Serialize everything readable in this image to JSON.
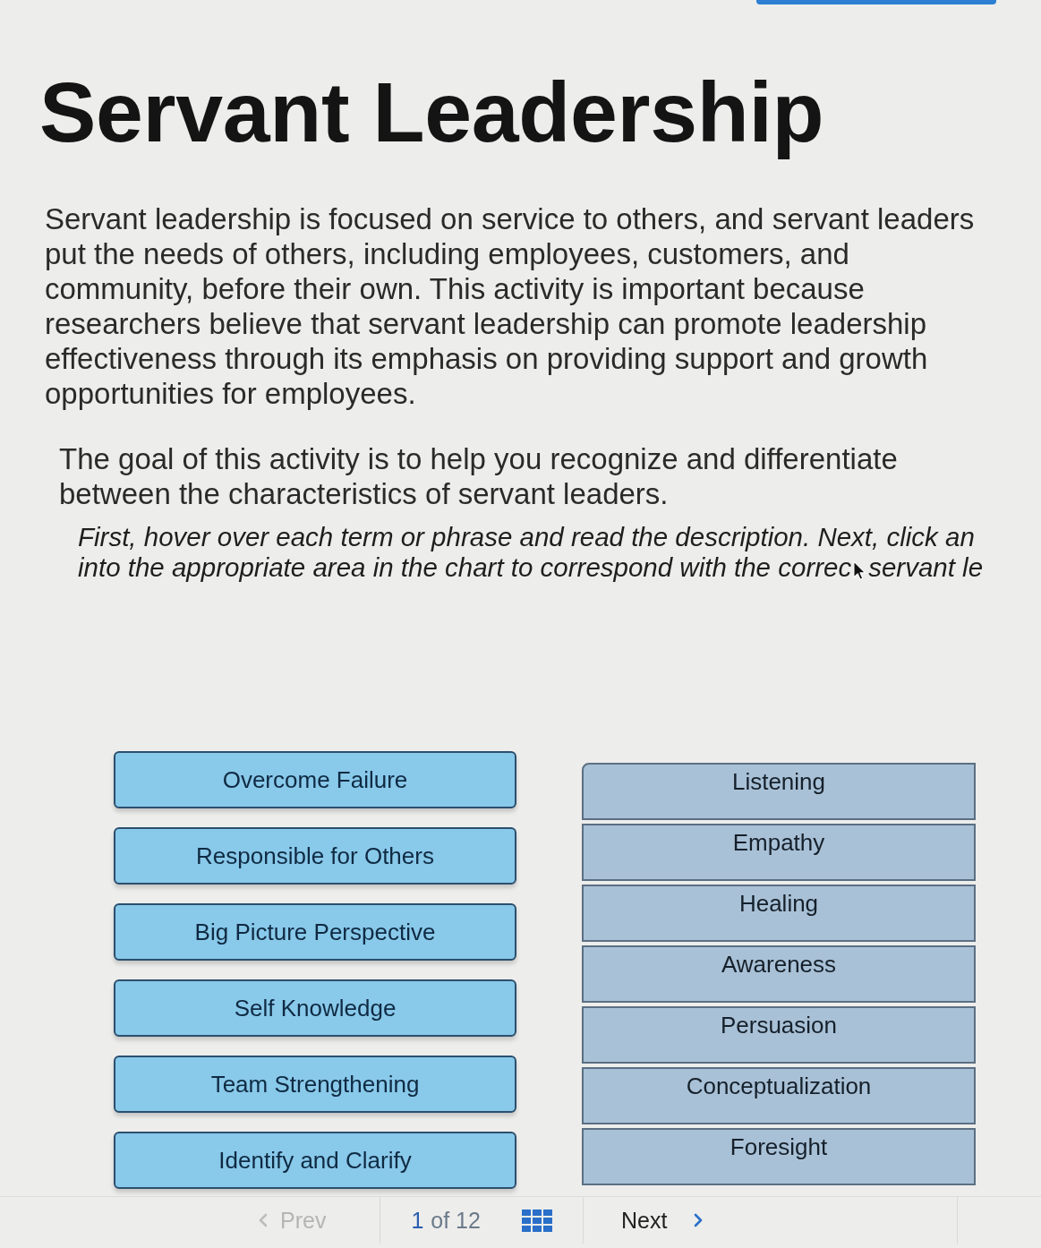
{
  "title": "Servant Leadership",
  "intro": [
    "Servant leadership is focused on service to others, and servant leaders put the needs of others, including employees, customers, and community, before their own. This activity is important because researchers believe that servant leadership can promote leadership effectiveness through its emphasis on providing support and growth opportunities for employees.",
    "The goal of this activity is to help you recognize and differentiate between the characteristics of servant leaders."
  ],
  "instructions": [
    [
      "First, hover over each term or phrase and read the description. Next, click an"
    ],
    [
      "into the appropriate area in the chart to correspond with the correc",
      "servant le"
    ]
  ],
  "terms": [
    {
      "label": "Overcome Failure"
    },
    {
      "label": "Responsible for Others"
    },
    {
      "label": "Big Picture Perspective"
    },
    {
      "label": "Self Knowledge"
    },
    {
      "label": "Team Strengthening"
    },
    {
      "label": "Identify and Clarify"
    }
  ],
  "categories": [
    {
      "label": "Listening"
    },
    {
      "label": "Empathy"
    },
    {
      "label": "Healing"
    },
    {
      "label": "Awareness"
    },
    {
      "label": "Persuasion"
    },
    {
      "label": "Conceptualization"
    },
    {
      "label": "Foresight"
    }
  ],
  "pagination": {
    "prev": {
      "label": "Prev",
      "disabled": true
    },
    "current": "1",
    "total": "of 12",
    "next": {
      "label": "Next",
      "disabled": false
    }
  }
}
